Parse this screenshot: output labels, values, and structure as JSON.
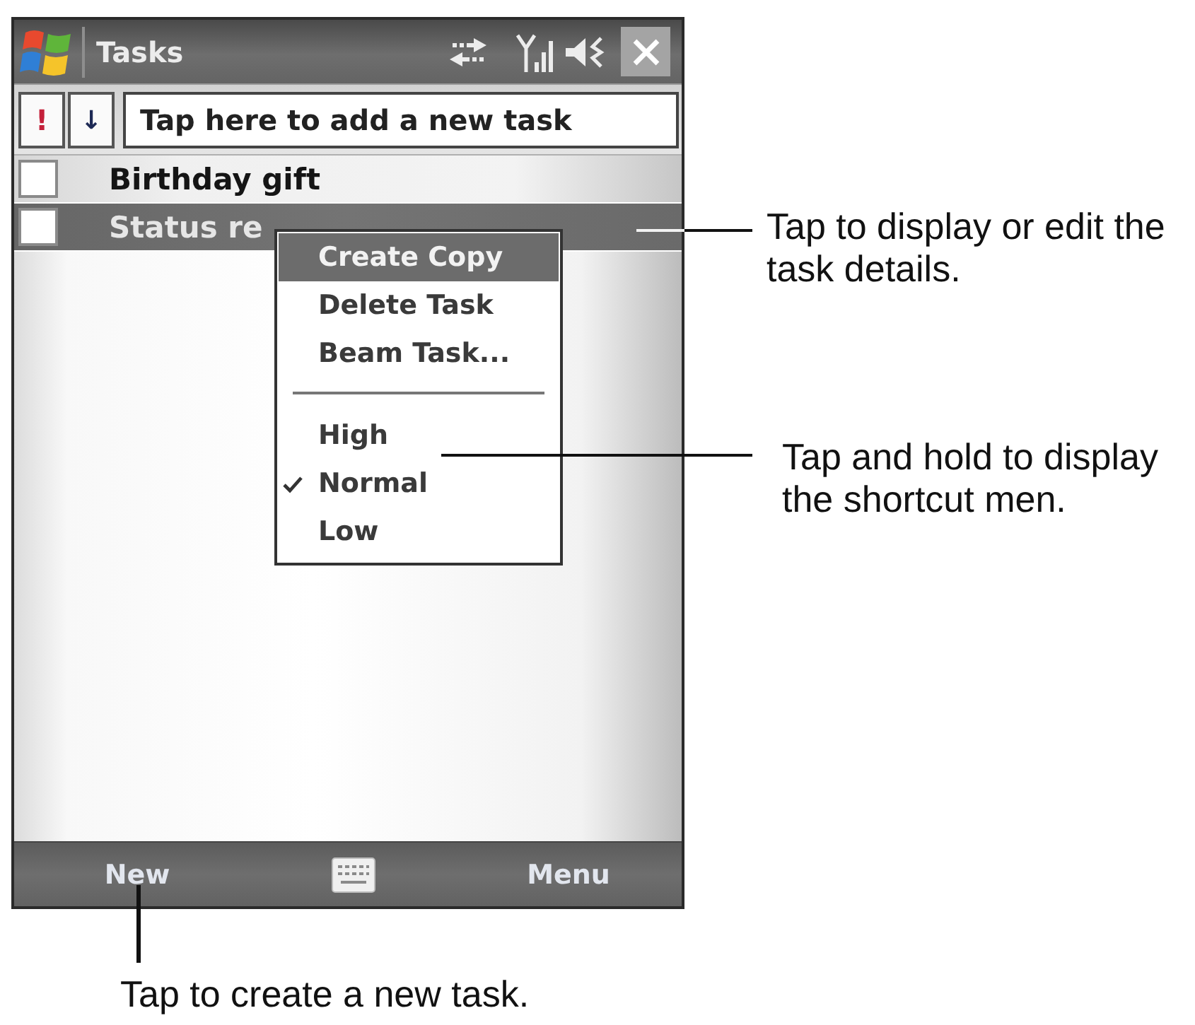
{
  "window": {
    "title": "Tasks"
  },
  "toolbar": {
    "priority_button": "!",
    "sort_button": "↓",
    "new_task_field": {
      "placeholder": "Tap here to add a new task"
    }
  },
  "tasks": [
    {
      "title": "Birthday gift",
      "checked": false,
      "selected": false
    },
    {
      "title": "Status re",
      "checked": false,
      "selected": true
    }
  ],
  "context_menu": {
    "sections": [
      {
        "items": [
          {
            "label": "Create Copy",
            "selected": true,
            "checked": false
          },
          {
            "label": "Delete Task",
            "selected": false,
            "checked": false
          },
          {
            "label": "Beam Task...",
            "selected": false,
            "checked": false
          }
        ]
      },
      {
        "items": [
          {
            "label": "High",
            "selected": false,
            "checked": false
          },
          {
            "label": "Normal",
            "selected": false,
            "checked": true
          },
          {
            "label": "Low",
            "selected": false,
            "checked": false
          }
        ]
      }
    ]
  },
  "command_bar": {
    "left_button": "New",
    "right_button": "Menu"
  },
  "callouts": [
    {
      "kind": "side",
      "text": "Tap to display or edit the task details."
    },
    {
      "kind": "side",
      "text": "Tap and hold to display the shortcut men."
    },
    {
      "kind": "below",
      "text": "Tap to create a new task."
    }
  ]
}
